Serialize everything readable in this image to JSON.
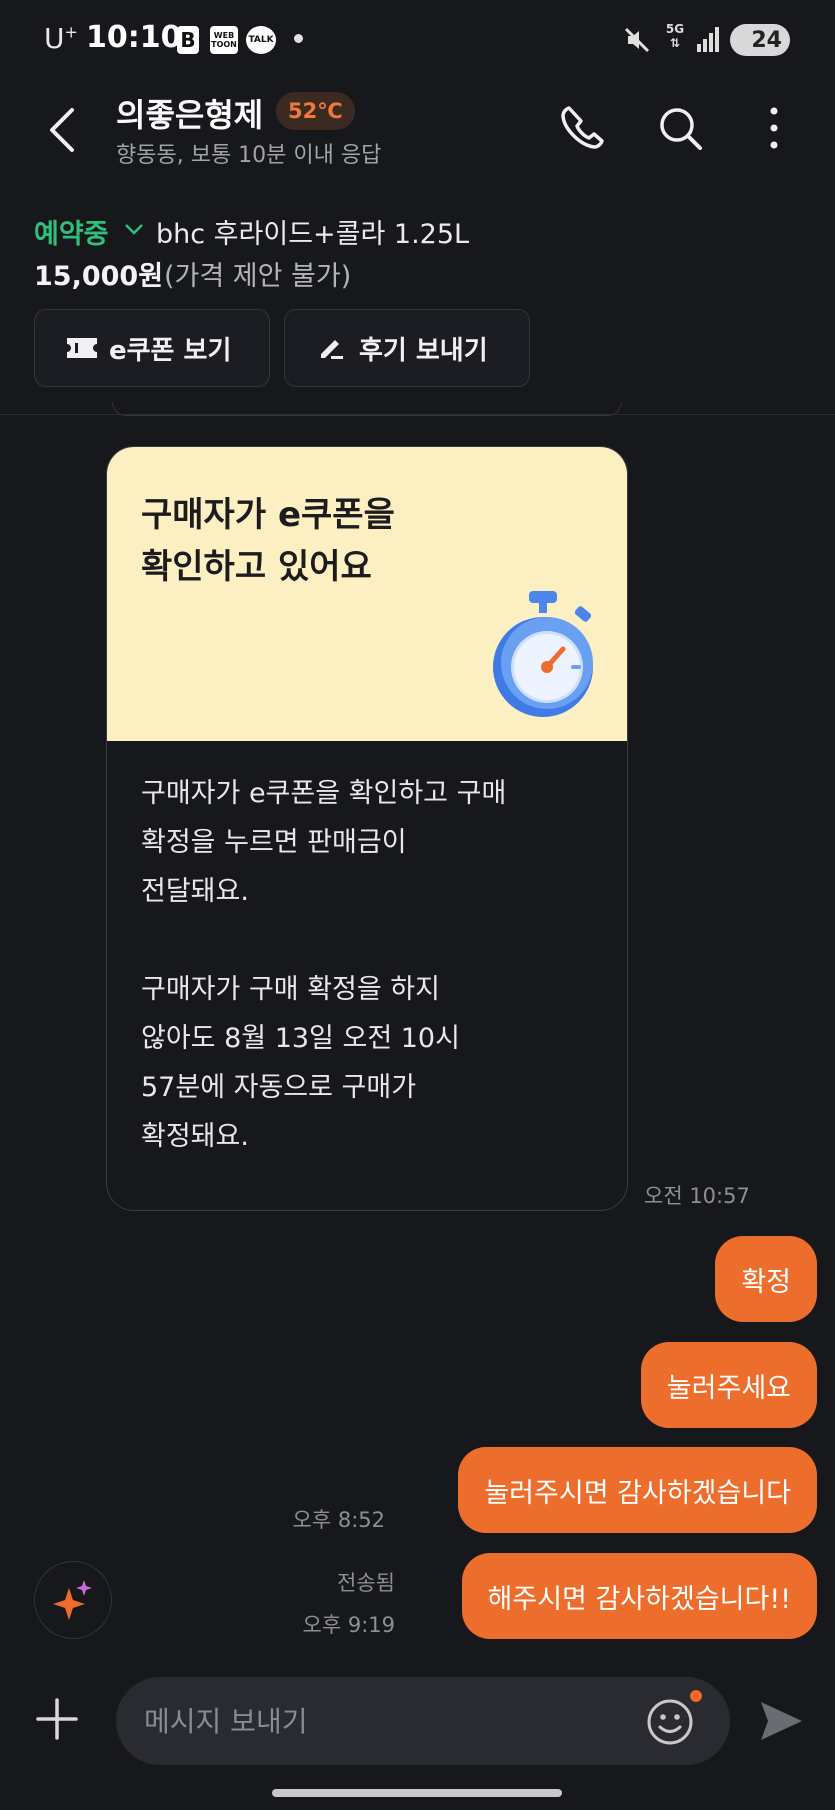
{
  "status_bar": {
    "carrier": "U",
    "carrier_sup": "+",
    "time": "10:10",
    "app_b": "B",
    "app_webtoon": "WEB TOON",
    "app_talk": "TALK",
    "network": "5G",
    "battery": "24"
  },
  "header": {
    "title": "의좋은형제",
    "temperature": "52℃",
    "subtitle": "향동동, 보통 10분 이내 응답"
  },
  "product": {
    "status": "예약중",
    "name": "bhc 후라이드+콜라 1.25L",
    "price": "15,000원",
    "price_note": "(가격 제안 불가)",
    "coupon_button": "e쿠폰 보기",
    "review_button": "후기 보내기"
  },
  "card": {
    "title_line1": "구매자가 e쿠폰을",
    "title_line2": "확인하고 있어요",
    "body": [
      [
        "구매자가 e쿠폰을 확인하고 구매",
        "확정을 누르면 판매금이",
        "전달돼요."
      ],
      [
        "구매자가 구매 확정을 하지",
        "않아도 8월 13일 오전 10시",
        "57분에 자동으로 구매가",
        "확정돼요."
      ]
    ],
    "time": "오전 10:57"
  },
  "messages": [
    {
      "text": "확정"
    },
    {
      "text": "눌러주세요"
    },
    {
      "text": "눌러주시면 감사하겠습니다",
      "time": "오후 8:52"
    },
    {
      "text": "해주시면 감사하겠습니다!!",
      "status": "전송됨",
      "time": "오후 9:19"
    }
  ],
  "input": {
    "placeholder": "메시지 보내기"
  },
  "colors": {
    "accent": "#ec6d2c",
    "reserved_green": "#2fbf7a",
    "card_banner": "#fcf0c2",
    "background": "#17181c"
  }
}
